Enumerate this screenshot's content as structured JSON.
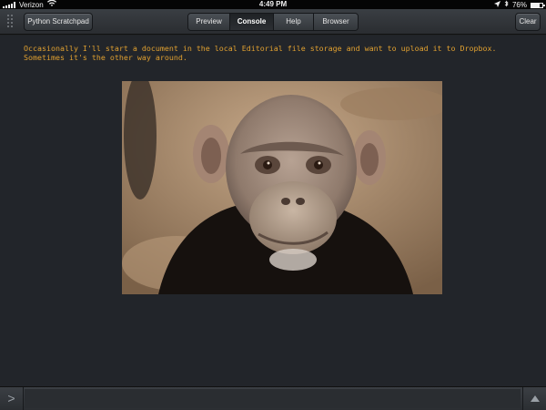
{
  "status_bar": {
    "carrier": "Verizon",
    "time": "4:49 PM",
    "battery_percent": "76%",
    "battery_level": 0.76,
    "icons": [
      "signal-bars-icon",
      "wifi-icon",
      "location-arrow-icon",
      "bluetooth-icon",
      "battery-icon"
    ]
  },
  "toolbar": {
    "scratchpad_label": "Python Scratchpad",
    "tabs": [
      {
        "label": "Preview",
        "active": false
      },
      {
        "label": "Console",
        "active": true
      },
      {
        "label": "Help",
        "active": false
      },
      {
        "label": "Browser",
        "active": false
      }
    ],
    "clear_label": "Clear"
  },
  "console": {
    "output_text": "Occasionally I'll start a document in the local Editorial file storage and want to upload it to Dropbox.\nSometimes it's the other way around.",
    "text_color": "#e0a030",
    "image_subject": "chimpanzee-photo"
  },
  "input_bar": {
    "prompt_symbol": ">",
    "value": "",
    "icons": [
      "prompt-chevron-icon",
      "history-up-arrow-icon"
    ]
  },
  "colors": {
    "background": "#22252a",
    "toolbar": "#33373b",
    "accent_text": "#e0a030"
  }
}
